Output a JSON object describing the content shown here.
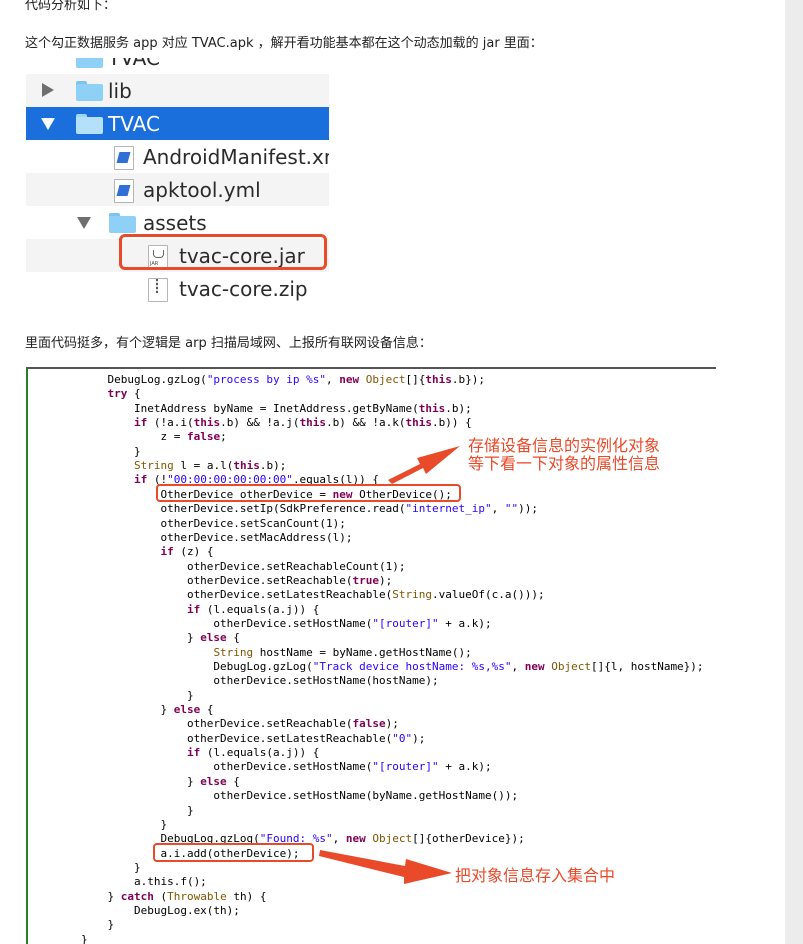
{
  "article": {
    "top_text": "代码分析如下：",
    "intro": "这个勾正数据服务 app 对应 TVAC.apk ，解开看功能基本都在这个动态加载的 jar 里面：",
    "middle": "里面代码挺多，有个逻辑是 arp 扫描局域网、上报所有联网设备信息："
  },
  "tree": {
    "top_partial": "TVAC",
    "items": [
      {
        "label": "lib"
      },
      {
        "label": "TVAC"
      },
      {
        "label": "AndroidManifest.xml"
      },
      {
        "label": "apktool.yml"
      },
      {
        "label": "assets"
      },
      {
        "label": "tvac-core.jar"
      },
      {
        "label": "tvac-core.zip"
      }
    ],
    "jar_tag": "JAR"
  },
  "code_lines": [
    "            DebugLog.gzLog(\"process by ip %s\", new Object[]{this.b});",
    "            try {",
    "                InetAddress byName = InetAddress.getByName(this.b);",
    "                if (!a.i(this.b) && !a.j(this.b) && !a.k(this.b)) {",
    "                    z = false;",
    "                }",
    "                String l = a.l(this.b);",
    "                if (!\"00:00:00:00:00:00\".equals(l)) {",
    "                    OtherDevice otherDevice = new OtherDevice();",
    "                    otherDevice.setIp(SdkPreference.read(\"internet_ip\", \"\"));",
    "                    otherDevice.setScanCount(1);",
    "                    otherDevice.setMacAddress(l);",
    "                    if (z) {",
    "                        otherDevice.setReachableCount(1);",
    "                        otherDevice.setReachable(true);",
    "                        otherDevice.setLatestReachable(String.valueOf(c.a()));",
    "                        if (l.equals(a.j)) {",
    "                            otherDevice.setHostName(\"[router]\" + a.k);",
    "                        } else {",
    "                            String hostName = byName.getHostName();",
    "                            DebugLog.gzLog(\"Track device hostName: %s,%s\", new Object[]{l, hostName});",
    "                            otherDevice.setHostName(hostName);",
    "                        }",
    "                    } else {",
    "                        otherDevice.setReachable(false);",
    "                        otherDevice.setLatestReachable(\"0\");",
    "                        if (l.equals(a.j)) {",
    "                            otherDevice.setHostName(\"[router]\" + a.k);",
    "                        } else {",
    "                            otherDevice.setHostName(byName.getHostName());",
    "                        }",
    "                    }",
    "                    DebugLog.gzLog(\"Found: %s\", new Object[]{otherDevice});",
    "                    a.i.add(otherDevice);",
    "                }",
    "                a.this.f();",
    "            } catch (Throwable th) {",
    "                DebugLog.ex(th);",
    "            }",
    "        }"
  ],
  "annotations": {
    "note1_line1": "存储设备信息的实例化对象",
    "note1_line2": "等下看一下对象的属性信息",
    "note2": "把对象信息存入集合中"
  },
  "colors": {
    "accent": "#e94a2a",
    "selection": "#1a6fdc",
    "keyword": "#7f0055",
    "string": "#2a00ff"
  }
}
